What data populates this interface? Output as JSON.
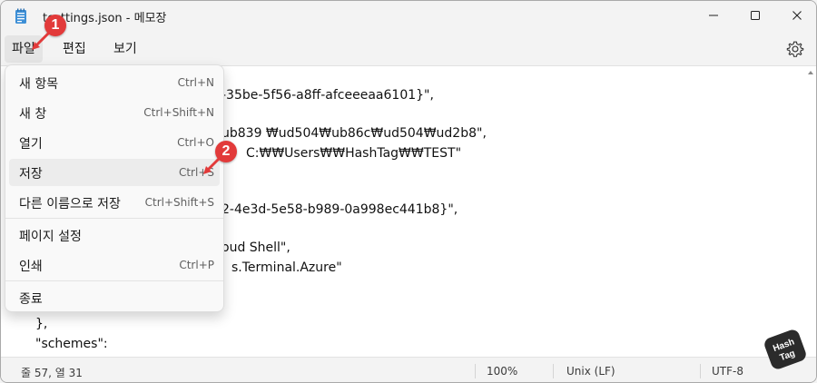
{
  "window": {
    "title": "test_settings.json - 메모장",
    "title_visible": "testtings.json - 메모장",
    "icons": [
      "notepad-icon",
      "minimize-icon",
      "maximize-icon",
      "close-icon"
    ]
  },
  "menubar": {
    "file": "파일",
    "edit": "편집",
    "view": "보기",
    "settings_icon": "gear-icon"
  },
  "file_menu": {
    "items": [
      {
        "label": "새 항목",
        "accel": "Ctrl+N"
      },
      {
        "label": "새 창",
        "accel": "Ctrl+Shift+N"
      },
      {
        "label": "열기",
        "accel": "Ctrl+O"
      },
      {
        "label": "저장",
        "accel": "Ctrl+S"
      },
      {
        "label": "다른 이름으로 저장",
        "accel": "Ctrl+Shift+S"
      },
      {
        "label": "페이지 설정",
        "accel": ""
      },
      {
        "label": "인쇄",
        "accel": "Ctrl+P"
      },
      {
        "label": "종료",
        "accel": ""
      }
    ]
  },
  "editor": {
    "lines": [
      "-35be-5f56-a8ff-afceeeaa6101}\",",
      "ub839 ₩ud504₩ub86c₩ud504₩ud2b8\",",
      "C:₩₩Users₩₩HashTag₩₩TEST\"",
      "2-4e3d-5e58-b989-0a998ec441b8}\",",
      "oud Shell\",",
      "s.Terminal.Azure\"",
      "},",
      "\"schemes\":"
    ]
  },
  "statusbar": {
    "position": "줄 57, 열 31",
    "zoom": "100%",
    "line_ending": "Unix (LF)",
    "encoding": "UTF-8"
  },
  "callouts": {
    "one": "1",
    "two": "2"
  },
  "logo": {
    "text_line1": "Hash",
    "text_line2": "Tag"
  },
  "colors": {
    "accent_badge": "#e23a3a",
    "menu_bg": "#f9f9f9",
    "highlight": "#ececec"
  }
}
